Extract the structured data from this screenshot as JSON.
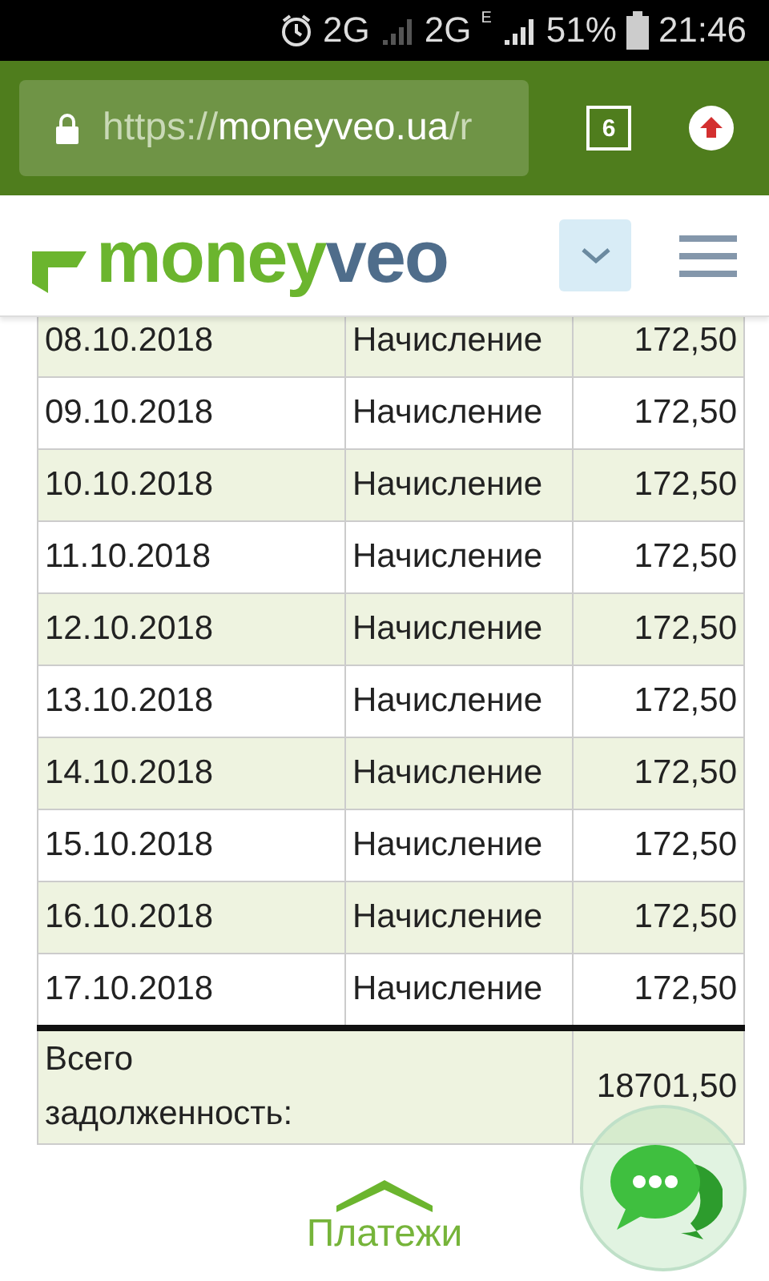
{
  "status_bar": {
    "network_1": "2G",
    "network_2": "2G",
    "network_2_sub": "E",
    "battery": "51%",
    "time": "21:46"
  },
  "browser": {
    "url_scheme": "https://",
    "url_host": "moneyveo.ua",
    "url_path": "/r",
    "tab_count": "6"
  },
  "header": {
    "logo_part_1": "money",
    "logo_part_2": "veo"
  },
  "table": {
    "rows": [
      {
        "date": "08.10.2018",
        "type": "Начисление",
        "amount": "172,50"
      },
      {
        "date": "09.10.2018",
        "type": "Начисление",
        "amount": "172,50"
      },
      {
        "date": "10.10.2018",
        "type": "Начисление",
        "amount": "172,50"
      },
      {
        "date": "11.10.2018",
        "type": "Начисление",
        "amount": "172,50"
      },
      {
        "date": "12.10.2018",
        "type": "Начисление",
        "amount": "172,50"
      },
      {
        "date": "13.10.2018",
        "type": "Начисление",
        "amount": "172,50"
      },
      {
        "date": "14.10.2018",
        "type": "Начисление",
        "amount": "172,50"
      },
      {
        "date": "15.10.2018",
        "type": "Начисление",
        "amount": "172,50"
      },
      {
        "date": "16.10.2018",
        "type": "Начисление",
        "amount": "172,50"
      },
      {
        "date": "17.10.2018",
        "type": "Начисление",
        "amount": "172,50"
      }
    ],
    "total_label": "Всего задолженность:",
    "total_amount": "18701,50"
  },
  "footer": {
    "link": "Платежи"
  }
}
